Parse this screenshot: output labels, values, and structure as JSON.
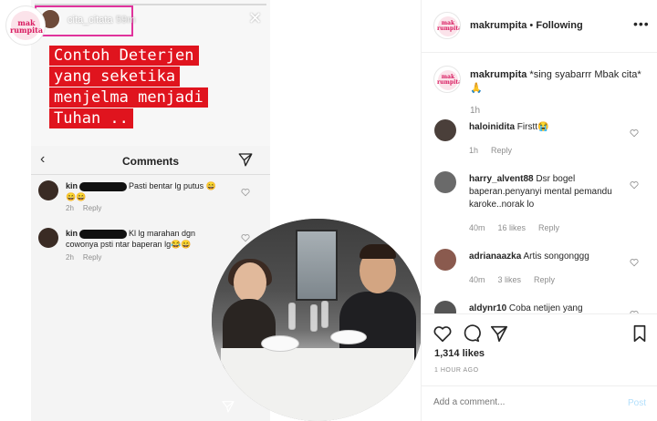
{
  "story": {
    "username": "cita_citata",
    "time": "59m",
    "caption_lines": [
      "Contoh Deterjen",
      "yang seketika",
      "menjelma menjadi",
      "Tuhan .."
    ],
    "comments_title": "Comments",
    "comments": [
      {
        "user": "kin",
        "text": "Pasti bentar lg putus 😄",
        "text2": "😄😄",
        "time": "2h",
        "reply": "Reply"
      },
      {
        "user": "kin",
        "text": "Kl lg marahan dgn",
        "text2": "cowonya psti ntar baperan lg😂😄",
        "time": "2h",
        "reply": "Reply"
      }
    ]
  },
  "logo": {
    "line1": "mak",
    "line2": "rumpita"
  },
  "post": {
    "username": "makrumpita",
    "separator": "•",
    "follow_status": "Following",
    "more": "•••",
    "caption_user": "makrumpita",
    "caption_text": "*sing syabarrr Mbak cita* 🙏",
    "caption_time": "1h",
    "comments": [
      {
        "user": "haloinidita",
        "text": "Firstt😭",
        "time": "1h",
        "likes": "",
        "reply": "Reply"
      },
      {
        "user": "harry_alvent88",
        "text": "Dsr bogel baperan.penyanyi mental pemandu karoke..norak lo",
        "time": "40m",
        "likes": "16 likes",
        "reply": "Reply"
      },
      {
        "user": "adrianaazka",
        "text": "Artis songonggg",
        "time": "40m",
        "likes": "3 likes",
        "reply": "Reply"
      },
      {
        "user": "aldynr10",
        "text": "Coba netijen yang",
        "time": "",
        "likes": "",
        "reply": ""
      }
    ],
    "likes": "1,314 likes",
    "ago": "1 HOUR AGO",
    "add_comment_placeholder": "Add a comment...",
    "post_button": "Post"
  },
  "colors": {
    "highlight_box": "#e0339c",
    "caption_bg": "#e0141e",
    "brand_pink": "#d81b60",
    "post_disabled": "#b2dffc"
  }
}
